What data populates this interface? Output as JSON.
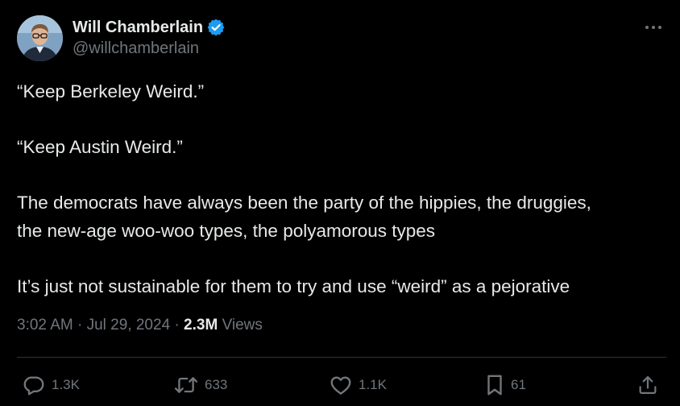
{
  "author": {
    "display_name": "Will Chamberlain",
    "handle": "@willchamberlain",
    "verified": true,
    "avatar": "avatar-photo-man-glasses"
  },
  "tweet": {
    "lines": [
      "“Keep Berkeley Weird.”",
      "“Keep Austin Weird.”",
      "The democrats have always been the party of the hippies, the druggies,",
      "the new-age woo-woo types, the polyamorous types",
      "It’s just not sustainable for them to try and use “weird” as a pejorative"
    ]
  },
  "meta": {
    "time": "3:02 AM",
    "separator": "·",
    "date": "Jul 29, 2024",
    "views_count": "2.3M",
    "views_label": "Views"
  },
  "actions": {
    "replies": "1.3K",
    "reposts": "633",
    "likes": "1.1K",
    "bookmarks": "61"
  },
  "icons": {
    "more": "more-horizontal-icon",
    "reply": "reply-icon",
    "repost": "repost-icon",
    "like": "heart-icon",
    "bookmark": "bookmark-icon",
    "share": "share-icon",
    "verified": "verified-badge-icon"
  },
  "colors": {
    "background": "#000000",
    "text_primary": "#e7e9ea",
    "text_secondary": "#71767b",
    "verified_blue": "#1d9bf0",
    "divider": "#2f3336"
  }
}
